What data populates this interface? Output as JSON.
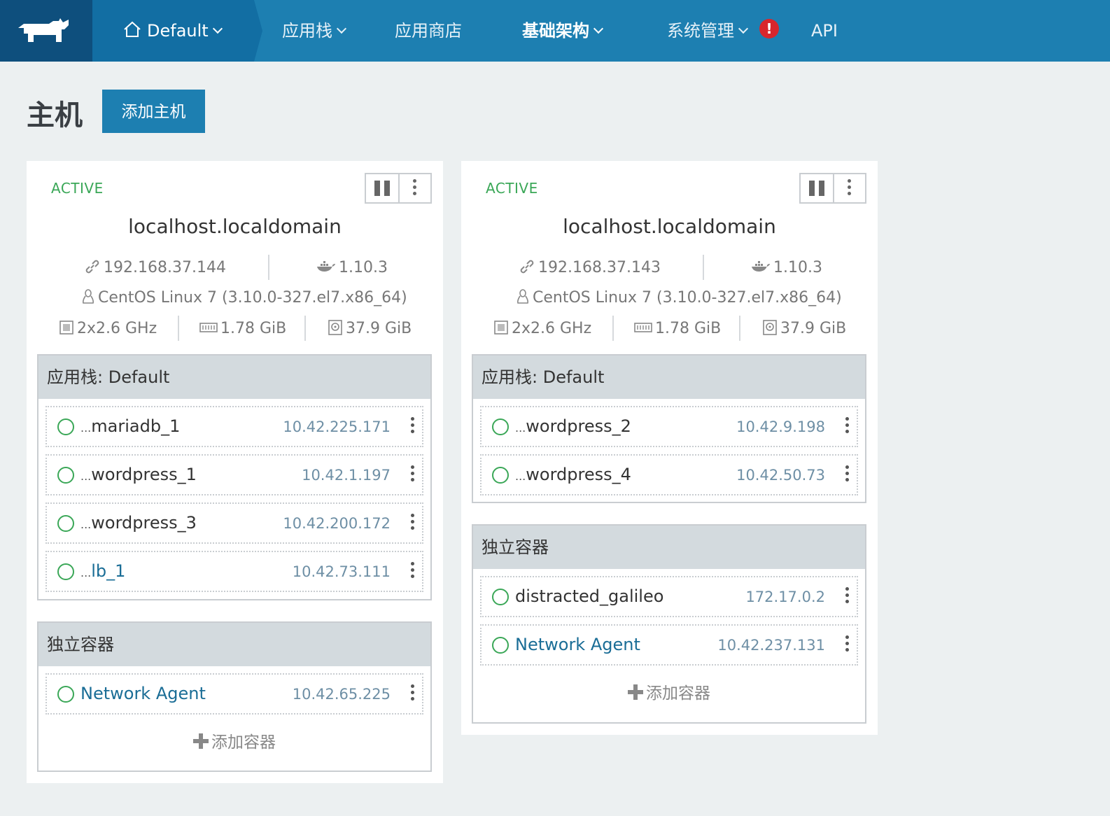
{
  "nav": {
    "environment": "Default",
    "items": [
      {
        "label": "应用栈"
      },
      {
        "label": "应用商店"
      },
      {
        "label": "基础架构"
      },
      {
        "label": "系统管理"
      },
      {
        "label": "API"
      }
    ],
    "alert": "!"
  },
  "page": {
    "title": "主机",
    "add_host": "添加主机"
  },
  "hosts": [
    {
      "state": "ACTIVE",
      "name": "localhost.localdomain",
      "ip": "192.168.37.144",
      "docker": "1.10.3",
      "os": "CentOS Linux 7 (3.10.0-327.el7.x86_64)",
      "cpu": "2x2.6 GHz",
      "memory": "1.78 GiB",
      "storage": "37.9 GiB",
      "stack_section": "应用栈: Default",
      "stack_containers": [
        {
          "prefix": "...",
          "name": "mariadb_1",
          "ip": "10.42.225.171"
        },
        {
          "prefix": "...",
          "name": "wordpress_1",
          "ip": "10.42.1.197"
        },
        {
          "prefix": "...",
          "name": "wordpress_3",
          "ip": "10.42.200.172"
        },
        {
          "prefix": "...",
          "name": "lb_1",
          "ip": "10.42.73.111"
        }
      ],
      "standalone_section": "独立容器",
      "standalone_containers": [
        {
          "name": "Network Agent",
          "ip": "10.42.65.225"
        }
      ],
      "add_container": "添加容器"
    },
    {
      "state": "ACTIVE",
      "name": "localhost.localdomain",
      "ip": "192.168.37.143",
      "docker": "1.10.3",
      "os": "CentOS Linux 7 (3.10.0-327.el7.x86_64)",
      "cpu": "2x2.6 GHz",
      "memory": "1.78 GiB",
      "storage": "37.9 GiB",
      "stack_section": "应用栈: Default",
      "stack_containers": [
        {
          "prefix": "...",
          "name": "wordpress_2",
          "ip": "10.42.9.198"
        },
        {
          "prefix": "...",
          "name": "wordpress_4",
          "ip": "10.42.50.73"
        }
      ],
      "standalone_section": "独立容器",
      "standalone_containers": [
        {
          "name": "distracted_galileo",
          "ip": "172.17.0.2"
        },
        {
          "name": "Network Agent",
          "ip": "10.42.237.131"
        }
      ],
      "add_container": "添加容器"
    }
  ]
}
